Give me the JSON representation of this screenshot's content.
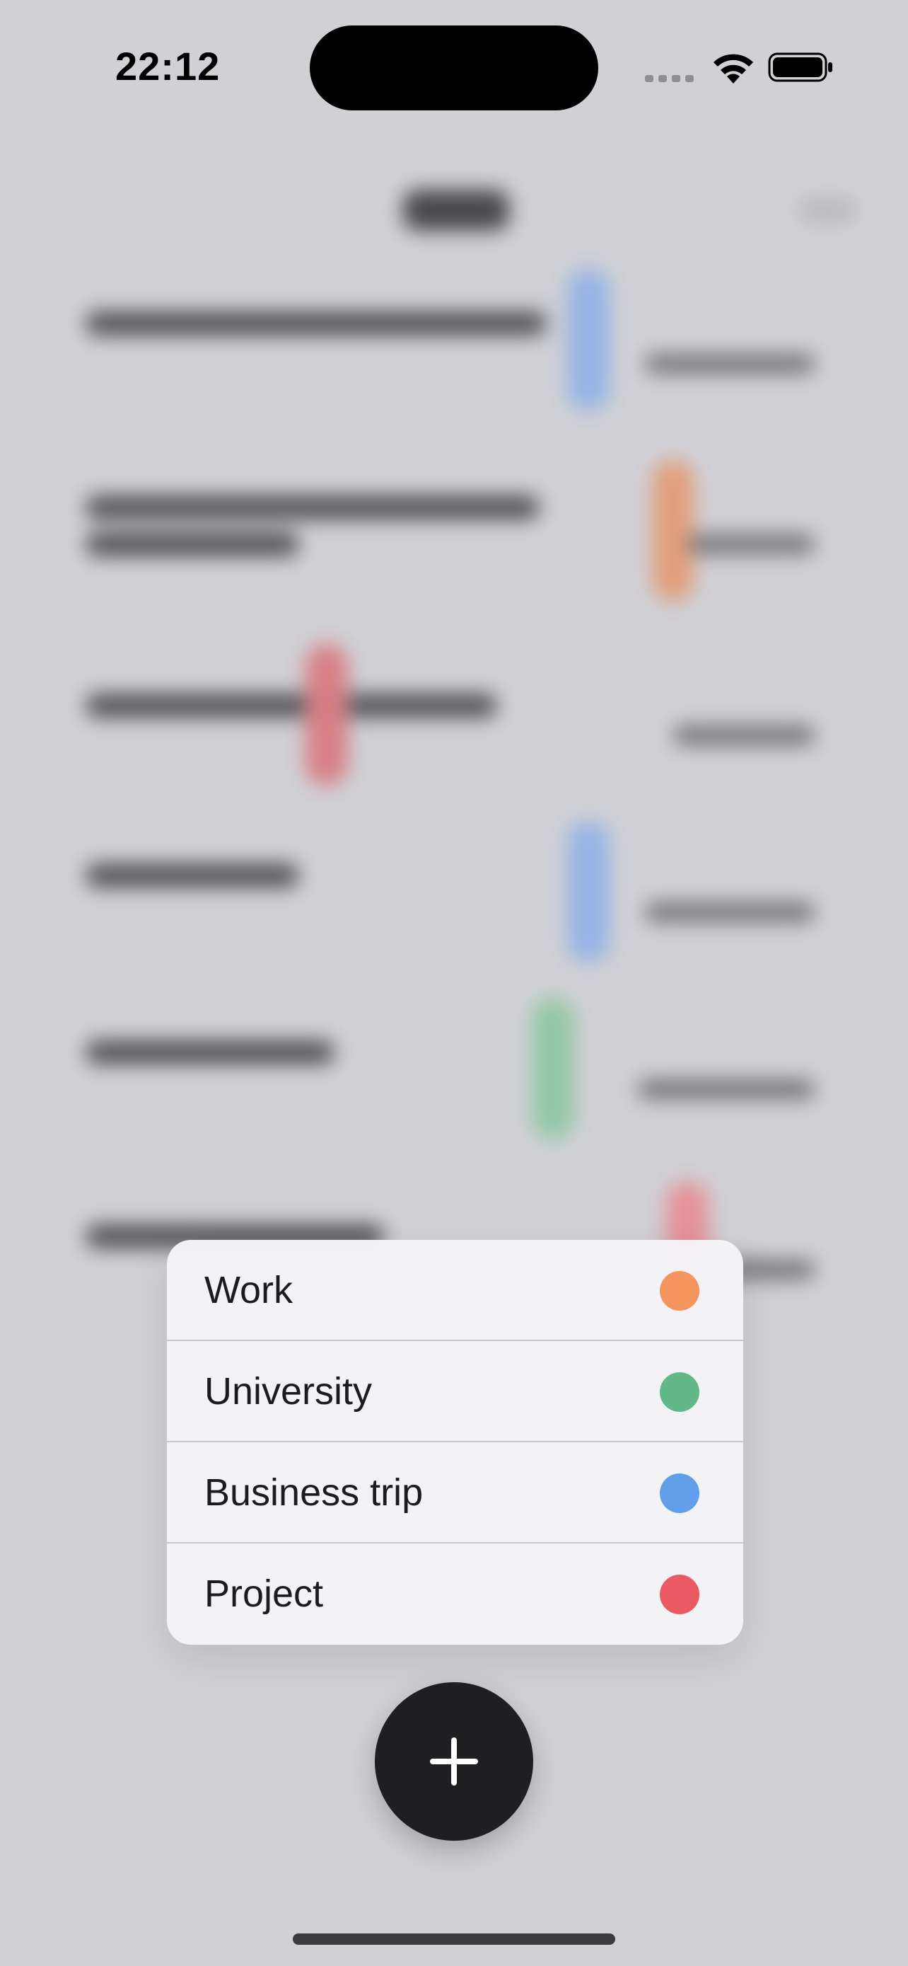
{
  "status_bar": {
    "time": "22:12"
  },
  "category_menu": {
    "items": [
      {
        "label": "Work",
        "color": "#F4955F"
      },
      {
        "label": "University",
        "color": "#62B889"
      },
      {
        "label": "Business trip",
        "color": "#619FEB"
      },
      {
        "label": "Project",
        "color": "#EA5A62"
      }
    ]
  },
  "colors": {
    "fab_background": "#1F1F21",
    "fab_icon": "#FFFFFF",
    "overlay_background": "#D0D0D5"
  },
  "icons": {
    "fab": "plus-icon",
    "wifi": "wifi-icon",
    "battery": "battery-icon"
  }
}
